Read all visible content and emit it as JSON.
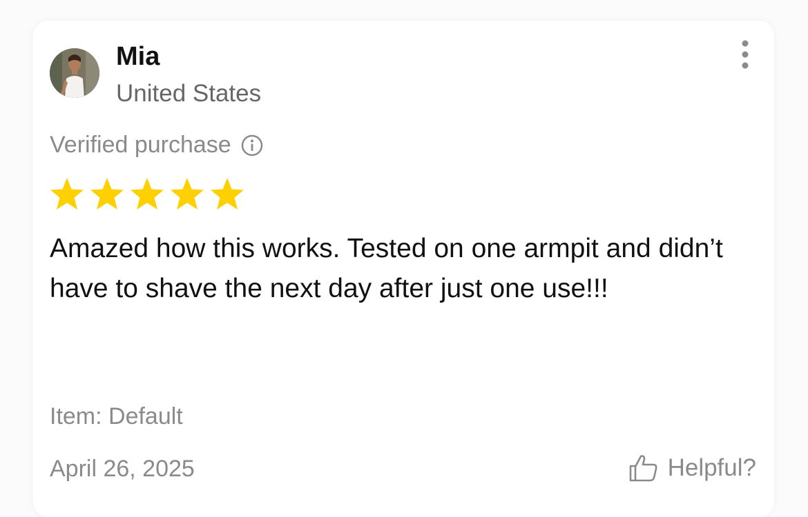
{
  "review": {
    "user": {
      "name": "Mia",
      "country": "United States",
      "avatar_icon": "user-photo"
    },
    "more_icon": "vertical-dots-icon",
    "verified_label": "Verified purchase",
    "verified_icon": "info-icon",
    "rating": {
      "value": 5,
      "max": 5,
      "star_color": "#FFD000"
    },
    "text": "Amazed how this works. Tested on one armpit and didn’t have to shave the next day after just one use!!!",
    "item_label": "Item: Default",
    "date": "April 26, 2025",
    "helpful_label": "Helpful?",
    "helpful_icon": "thumbs-up-icon"
  }
}
